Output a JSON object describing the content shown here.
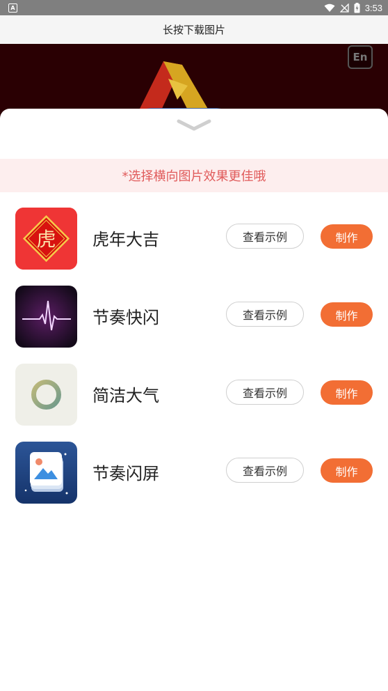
{
  "status_bar": {
    "time": "3:53",
    "left_icon": "A"
  },
  "title_bar": {
    "title": "长按下载图片"
  },
  "banner": {
    "badge": "En"
  },
  "sheet": {
    "tip": "*选择横向图片效果更佳哦",
    "items": [
      {
        "name": "虎年大吉",
        "icon": "tiger-new-year-icon",
        "icon_char": "虎",
        "example_label": "查看示例",
        "make_label": "制作"
      },
      {
        "name": "节奏快闪",
        "icon": "heartbeat-pulse-icon",
        "example_label": "查看示例",
        "make_label": "制作"
      },
      {
        "name": "简洁大气",
        "icon": "ring-icon",
        "example_label": "查看示例",
        "make_label": "制作"
      },
      {
        "name": "节奏闪屏",
        "icon": "photo-stack-icon",
        "example_label": "查看示例",
        "make_label": "制作"
      }
    ]
  },
  "colors": {
    "accent": "#f26e34",
    "tip_background": "#fdeeee",
    "tip_text": "#e05a5a",
    "banner_background": "#2a0003"
  }
}
